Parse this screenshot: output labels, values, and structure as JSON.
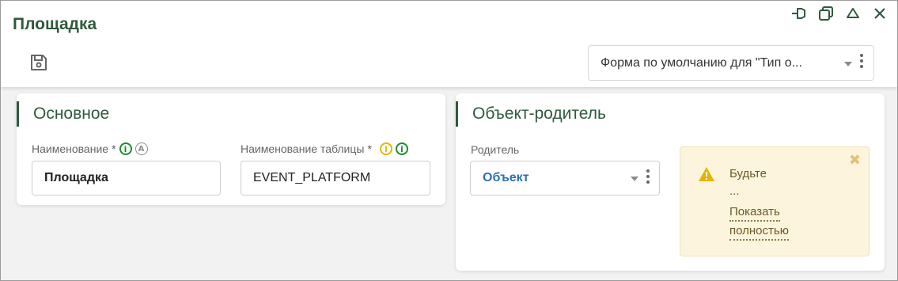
{
  "window": {
    "title": "Площадка",
    "controls": [
      "pin-icon",
      "restore-icon",
      "collapse-icon",
      "close-icon"
    ]
  },
  "toolbar": {
    "save_icon": "save-icon",
    "form_select_value": "Форма по умолчанию для \"Тип о..."
  },
  "main_section": {
    "title": "Основное",
    "name_field": {
      "label": "Наименование",
      "required_mark": "*",
      "value": "Площадка",
      "info_icon": "i",
      "auto_icon": "A"
    },
    "table_field": {
      "label": "Наименование таблицы",
      "required_mark": "*",
      "value": "EVENT_PLATFORM",
      "warn_icon": "i",
      "info_icon": "i"
    }
  },
  "parent_section": {
    "title": "Объект-родитель",
    "parent_field": {
      "label": "Родитель",
      "value": "Объект"
    },
    "warning": {
      "text_line1": "Будьте",
      "text_line2": "...",
      "link_line1": "Показать",
      "link_line2": "полностью",
      "close_glyph": "✖"
    }
  },
  "colors": {
    "accent": "#2e5a3c",
    "link": "#2e6fb3",
    "info_green": "#1f8a2a",
    "info_yellow": "#e6b400",
    "warning_bg": "#fcf4dc"
  }
}
